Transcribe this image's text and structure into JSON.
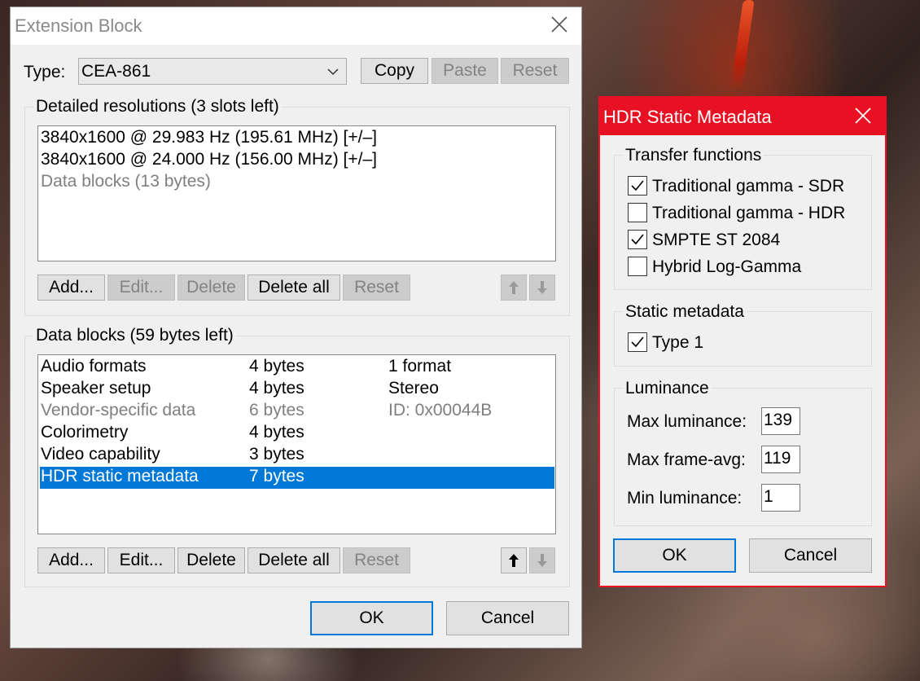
{
  "ext_window": {
    "title": "Extension Block",
    "type_label": "Type:",
    "type_value": "CEA-861",
    "copy": "Copy",
    "paste": "Paste",
    "reset": "Reset",
    "detailed": {
      "title": "Detailed resolutions (3 slots left)",
      "items": [
        "3840x1600 @ 29.983 Hz (195.61 MHz) [+/–]",
        "3840x1600 @ 24.000 Hz (156.00 MHz) [+/–]",
        "Data blocks (13 bytes)"
      ],
      "buttons": {
        "add": "Add...",
        "edit": "Edit...",
        "delete": "Delete",
        "delete_all": "Delete all",
        "reset": "Reset"
      }
    },
    "data_blocks": {
      "title": "Data blocks (59 bytes left)",
      "rows": [
        {
          "name": "Audio formats",
          "size": "4 bytes",
          "info": "1 format"
        },
        {
          "name": "Speaker setup",
          "size": "4 bytes",
          "info": "Stereo"
        },
        {
          "name": "Vendor-specific data",
          "size": "6 bytes",
          "info": "ID: 0x00044B"
        },
        {
          "name": "Colorimetry",
          "size": "4 bytes",
          "info": ""
        },
        {
          "name": "Video capability",
          "size": "3 bytes",
          "info": ""
        },
        {
          "name": "HDR static metadata",
          "size": "7 bytes",
          "info": ""
        }
      ],
      "buttons": {
        "add": "Add...",
        "edit": "Edit...",
        "delete": "Delete",
        "delete_all": "Delete all",
        "reset": "Reset"
      }
    },
    "ok": "OK",
    "cancel": "Cancel"
  },
  "hdr_window": {
    "title": "HDR Static Metadata",
    "transfer": {
      "title": "Transfer functions",
      "items": [
        {
          "label": "Traditional gamma - SDR",
          "checked": true
        },
        {
          "label": "Traditional gamma - HDR",
          "checked": false
        },
        {
          "label": "SMPTE ST 2084",
          "checked": true
        },
        {
          "label": "Hybrid Log-Gamma",
          "checked": false
        }
      ]
    },
    "static": {
      "title": "Static metadata",
      "items": [
        {
          "label": "Type 1",
          "checked": true
        }
      ]
    },
    "luminance": {
      "title": "Luminance",
      "max_label": "Max luminance:",
      "max_value": "139",
      "frame_label": "Max frame-avg:",
      "frame_value": "119",
      "min_label": "Min luminance:",
      "min_value": "1"
    },
    "ok": "OK",
    "cancel": "Cancel"
  },
  "colors": {
    "accent": "#0078d7",
    "hdr_title": "#e81123",
    "disabled_text": "#838383"
  }
}
